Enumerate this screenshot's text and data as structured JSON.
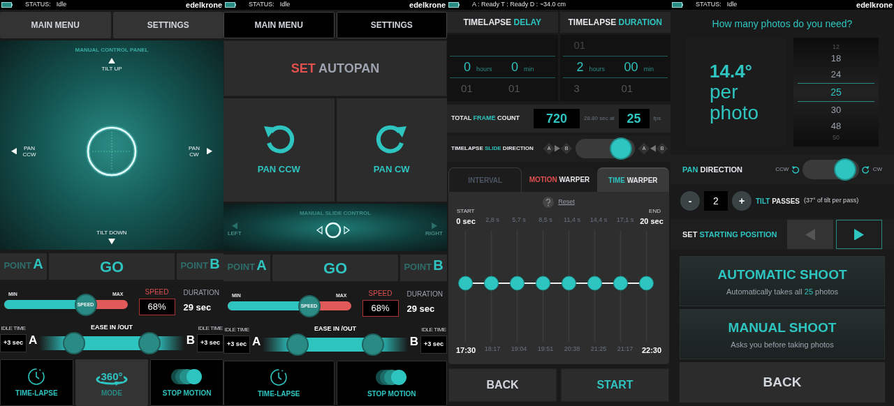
{
  "screens": [
    {
      "kind": "manual",
      "status": {
        "label": "STATUS:",
        "value": "Idle",
        "brand": "edelkrone"
      },
      "menu": [
        {
          "label": "MAIN MENU"
        },
        {
          "label": "SETTINGS"
        }
      ],
      "pad": {
        "title": "MANUAL CONTROL PANEL",
        "up": "TILT UP",
        "down": "TILT DOWN",
        "left": "PAN CCW",
        "right": "PAN CW"
      },
      "points": {
        "a": {
          "word": "POINT",
          "letter": "A"
        },
        "go": "GO",
        "b": {
          "word": "POINT",
          "letter": "B"
        }
      },
      "speed": {
        "min": "MIN",
        "max": "MAX",
        "thumb": "SPEED",
        "level": 0.66,
        "label": "SPEED",
        "value": "68%",
        "duration_label": "DURATION",
        "duration": "29 sec"
      },
      "ease": {
        "idle_left": {
          "label": "IDLE TIME",
          "value": "+3 sec"
        },
        "a": "A",
        "title": "EASE IN /OUT",
        "handles": [
          {
            "level": 0.24
          },
          {
            "level": 0.76
          }
        ],
        "b": "B",
        "idle_right": {
          "label": "IDLE TIME",
          "value": "+3 sec"
        }
      },
      "modes": [
        {
          "kind": "clock",
          "label": "TIME-LAPSE",
          "selected": false
        },
        {
          "kind": "rotate360",
          "badge": "360°",
          "label": "MODE",
          "selected": true
        },
        {
          "kind": "circles",
          "label": "STOP MOTION",
          "selected": false
        }
      ]
    },
    {
      "kind": "autopan",
      "status": {
        "label": "STATUS:",
        "value": "Idle",
        "brand": "edelkrone"
      },
      "menu": [
        {
          "label": "MAIN MENU"
        },
        {
          "label": "SETTINGS"
        }
      ],
      "title": [
        {
          "text": "SET",
          "color": "#e0504f"
        },
        {
          "text": "AUTOPAN",
          "color": "#9ca3af"
        }
      ],
      "pans": [
        {
          "kind": "ccw",
          "label": "PAN CCW"
        },
        {
          "kind": "cw",
          "label": "PAN CW"
        }
      ],
      "slide": {
        "title": "MANUAL SLIDE CONTROL",
        "left": "LEFT",
        "right": "RIGHT"
      },
      "points": {
        "a": {
          "word": "POINT",
          "letter": "A"
        },
        "go": "GO",
        "b": {
          "word": "POINT",
          "letter": "B"
        }
      },
      "speed": {
        "min": "MIN",
        "max": "MAX",
        "thumb": "SPEED",
        "level": 0.66,
        "label": "SPEED",
        "value": "68%",
        "duration_label": "DURATION",
        "duration": "29 sec"
      },
      "ease": {
        "idle_left": {
          "label": "IDLE TIME",
          "value": "+3 sec"
        },
        "a": "A",
        "title": "EASE IN /OUT",
        "handles": [
          {
            "level": 0.24
          },
          {
            "level": 0.76
          }
        ],
        "b": "B",
        "idle_right": {
          "label": "IDLE TIME",
          "value": "+3 sec"
        }
      },
      "modes": [
        {
          "kind": "clock",
          "label": "TIME-LAPSE",
          "selected": false
        },
        {
          "kind": "circles",
          "label": "STOP MOTION",
          "selected": false
        }
      ]
    },
    {
      "kind": "timelapse",
      "status": {
        "value": "A : Ready  T : Ready  D : ~34.0 cm"
      },
      "headers": [
        [
          {
            "text": "TIMELAPSE",
            "color": "#e5e7eb"
          },
          {
            "text": "DELAY",
            "color": "#2ec4c0"
          }
        ],
        [
          {
            "text": "TIMELAPSE",
            "color": "#e5e7eb"
          },
          {
            "text": "DURATION",
            "color": "#2ec4c0"
          }
        ]
      ],
      "pickers": [
        {
          "columns": [
            {
              "value": "0",
              "unit": "hours",
              "below": "01"
            },
            {
              "value": "0",
              "unit": "min",
              "below": "01"
            }
          ]
        },
        {
          "columns": [
            {
              "above": "01",
              "value": "2",
              "unit": "hours",
              "below": "3"
            },
            {
              "value": "00",
              "unit": "min",
              "below": "01"
            }
          ]
        }
      ],
      "frames": {
        "label": [
          {
            "text": "TOTAL",
            "color": "#e5e7eb"
          },
          {
            "text": "FRAME",
            "color": "#2ec4c0"
          },
          {
            "text": "COUNT",
            "color": "#e5e7eb"
          }
        ],
        "count": "720",
        "note": "28.80 sec at",
        "fps": "25",
        "unit": "fps"
      },
      "direction": {
        "label": [
          {
            "text": "TIMELAPSE",
            "color": "#e5e7eb"
          },
          {
            "text": "SLIDE",
            "color": "#2ec4c0"
          },
          {
            "text": "DIRECTION",
            "color": "#e5e7eb"
          }
        ],
        "forward": {
          "from": "A",
          "to": "B"
        },
        "on": true,
        "reverse": {
          "from": "A",
          "to": "B"
        }
      },
      "tabs": [
        {
          "parts": [
            {
              "text": "INTERVAL",
              "color": "#4b5563"
            }
          ],
          "selected": false,
          "disabled": true
        },
        {
          "parts": [
            {
              "text": "MOTION",
              "color": "#e0504f"
            },
            {
              "text": "WARPER",
              "color": "#e5e7eb"
            }
          ],
          "selected": false,
          "disabled": false
        },
        {
          "parts": [
            {
              "text": "TIME",
              "color": "#2ec4c0"
            },
            {
              "text": "WARPER",
              "color": "#e5e7eb"
            }
          ],
          "selected": true,
          "disabled": false
        }
      ],
      "warper": {
        "reset": "Reset",
        "start": "START",
        "end": "END",
        "offsets": [
          "0 sec",
          "2,8 s",
          "5,7 s",
          "8,5 s",
          "11,4 s",
          "14,4 s",
          "17,1 s",
          "20 sec"
        ],
        "times": [
          "17:30",
          "18:17",
          "19:04",
          "19:51",
          "20:38",
          "21:25",
          "21:17",
          "22:30"
        ]
      },
      "buttons": [
        {
          "kind": "back",
          "label": "BACK"
        },
        {
          "kind": "primary",
          "label": "START"
        }
      ]
    },
    {
      "kind": "panorama",
      "status": {
        "label": "STATUS:",
        "value": "Idle",
        "brand": "edelkrone"
      },
      "question": "How many photos do you need?",
      "angle": {
        "value": "14.4°",
        "line1": "per",
        "line2": "photo"
      },
      "counts": [
        {
          "label": "12",
          "selected": false
        },
        {
          "label": "18",
          "selected": false
        },
        {
          "label": "24",
          "selected": false
        },
        {
          "label": "25",
          "selected": true
        },
        {
          "label": "30",
          "selected": false
        },
        {
          "label": "48",
          "selected": false
        },
        {
          "label": "50",
          "selected": false
        }
      ],
      "pan_direction": {
        "label": [
          {
            "text": "PAN",
            "color": "#2ec4c0"
          },
          {
            "text": "DIRECTION",
            "color": "#e5e7eb"
          }
        ],
        "ccw": "CCW",
        "cw": "CW",
        "on": true
      },
      "tilt": {
        "minus": "-",
        "value": "2",
        "plus": "+",
        "label": [
          {
            "text": "TILT",
            "color": "#2ec4c0"
          },
          {
            "text": "PASSES",
            "color": "#e5e7eb"
          }
        ],
        "note": "(37° of tilt per pass)"
      },
      "start_position": {
        "label": [
          {
            "text": "SET",
            "color": "#e5e7eb"
          },
          {
            "text": "STARTING POSITION",
            "color": "#2ec4c0"
          }
        ],
        "buttons": [
          {
            "kind": "left",
            "selected": false
          },
          {
            "kind": "right",
            "selected": true
          }
        ]
      },
      "shoots": [
        {
          "title": "AUTOMATIC SHOOT",
          "subtitle": [
            {
              "text": "Automatically takes all",
              "color": "#9ca3af"
            },
            {
              "text": "25",
              "color": "#2ec4c0"
            },
            {
              "text": "photos",
              "color": "#9ca3af"
            }
          ]
        },
        {
          "title": "MANUAL SHOOT",
          "subtitle": [
            {
              "text": "Asks you before taking photos",
              "color": "#9ca3af"
            }
          ]
        }
      ],
      "back": "BACK"
    }
  ]
}
